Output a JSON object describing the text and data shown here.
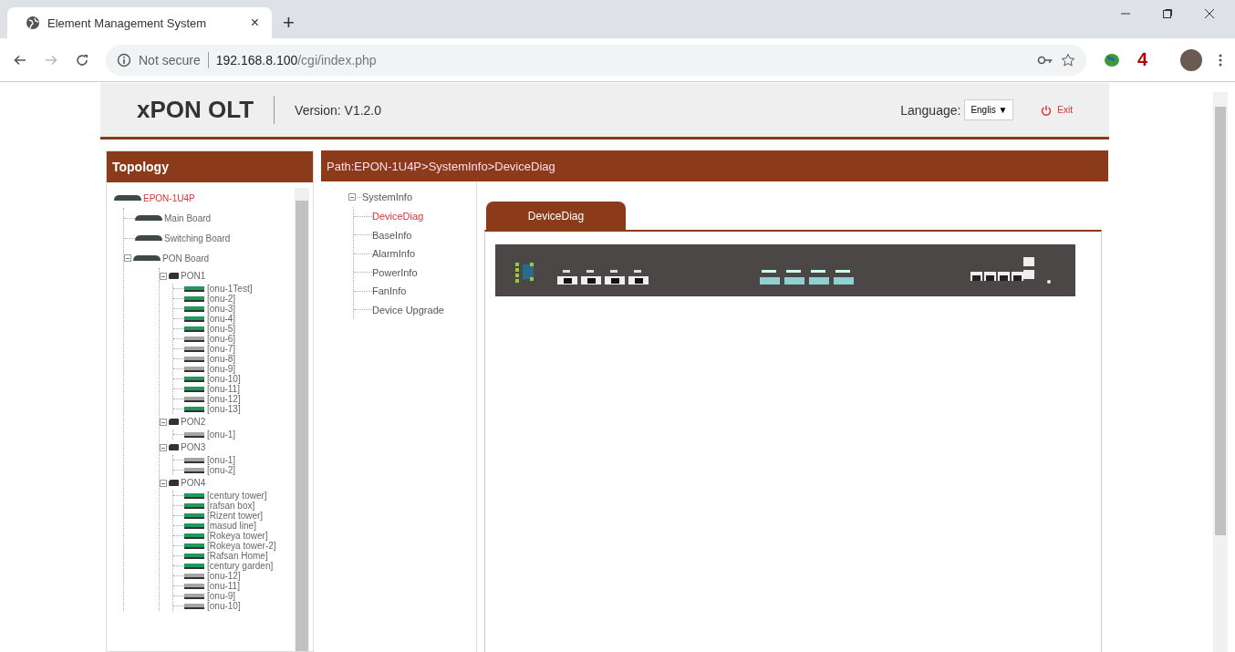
{
  "browser": {
    "tab_title": "Element Management System",
    "close": "×",
    "new_tab": "+",
    "security": "Not secure",
    "url_host": "192.168.8.100",
    "url_path": "/cgi/index.php",
    "extension_badge": "4"
  },
  "header": {
    "logo": "xPON OLT",
    "version": "Version: V1.2.0",
    "language_label": "Language:",
    "language_value": "Englis",
    "dropdown_arrow": "▼",
    "exit": "Exit"
  },
  "topology": {
    "title": "Topology",
    "tree": {
      "label": "EPON-1U4P",
      "kind": "root",
      "selected": true,
      "children": [
        {
          "label": "Main Board",
          "kind": "board"
        },
        {
          "label": "Switching Board",
          "kind": "board"
        },
        {
          "label": "PON Board",
          "kind": "board",
          "expanded": true,
          "children": [
            {
              "label": "PON1",
              "kind": "pon",
              "expanded": true,
              "children": [
                {
                  "label": "[onu-1Test]",
                  "kind": "onu",
                  "online": true
                },
                {
                  "label": "[onu-2]",
                  "kind": "onu",
                  "online": true
                },
                {
                  "label": "[onu-3]",
                  "kind": "onu",
                  "online": true
                },
                {
                  "label": "[onu-4]",
                  "kind": "onu",
                  "online": true
                },
                {
                  "label": "[onu-5]",
                  "kind": "onu",
                  "online": true
                },
                {
                  "label": "[onu-6]",
                  "kind": "onu",
                  "online": false
                },
                {
                  "label": "[onu-7]",
                  "kind": "onu",
                  "online": false
                },
                {
                  "label": "[onu-8]",
                  "kind": "onu",
                  "online": false
                },
                {
                  "label": "[onu-9]",
                  "kind": "onu",
                  "online": false
                },
                {
                  "label": "[onu-10]",
                  "kind": "onu",
                  "online": true
                },
                {
                  "label": "[onu-11]",
                  "kind": "onu",
                  "online": true
                },
                {
                  "label": "[onu-12]",
                  "kind": "onu",
                  "online": false
                },
                {
                  "label": "[onu-13]",
                  "kind": "onu",
                  "online": true
                }
              ]
            },
            {
              "label": "PON2",
              "kind": "pon",
              "expanded": true,
              "children": [
                {
                  "label": "[onu-1]",
                  "kind": "onu",
                  "online": false
                }
              ]
            },
            {
              "label": "PON3",
              "kind": "pon",
              "expanded": true,
              "children": [
                {
                  "label": "[onu-1]",
                  "kind": "onu",
                  "online": false
                },
                {
                  "label": "[onu-2]",
                  "kind": "onu",
                  "online": false
                }
              ]
            },
            {
              "label": "PON4",
              "kind": "pon",
              "expanded": true,
              "children": [
                {
                  "label": "[century tower]",
                  "kind": "onu",
                  "online": true
                },
                {
                  "label": "[rafsan box]",
                  "kind": "onu",
                  "online": true
                },
                {
                  "label": "[Rizent tower]",
                  "kind": "onu",
                  "online": true
                },
                {
                  "label": "[masud line]",
                  "kind": "onu",
                  "online": true
                },
                {
                  "label": "[Rokeya tower]",
                  "kind": "onu",
                  "online": true
                },
                {
                  "label": "[Rokeya tower-2]",
                  "kind": "onu",
                  "online": true
                },
                {
                  "label": "[Rafsan Home]",
                  "kind": "onu",
                  "online": true
                },
                {
                  "label": "[century garden]",
                  "kind": "onu",
                  "online": true
                },
                {
                  "label": "[onu-12]",
                  "kind": "onu",
                  "online": false
                },
                {
                  "label": "[onu-11]",
                  "kind": "onu",
                  "online": false
                },
                {
                  "label": "[onu-9]",
                  "kind": "onu",
                  "online": false
                },
                {
                  "label": "[onu-10]",
                  "kind": "onu",
                  "online": false
                }
              ]
            }
          ]
        }
      ]
    }
  },
  "path": "Path:EPON-1U4P>SystemInfo>DeviceDiag",
  "menu": {
    "label": "SystemInfo",
    "expanded": true,
    "items": [
      {
        "label": "DeviceDiag",
        "selected": true
      },
      {
        "label": "BaseInfo",
        "selected": false
      },
      {
        "label": "AlarmInfo",
        "selected": false
      },
      {
        "label": "PowerInfo",
        "selected": false
      },
      {
        "label": "FanInfo",
        "selected": false
      },
      {
        "label": "Device Upgrade",
        "selected": false
      }
    ]
  },
  "tabs": [
    {
      "label": "DeviceDiag",
      "selected": true
    }
  ]
}
